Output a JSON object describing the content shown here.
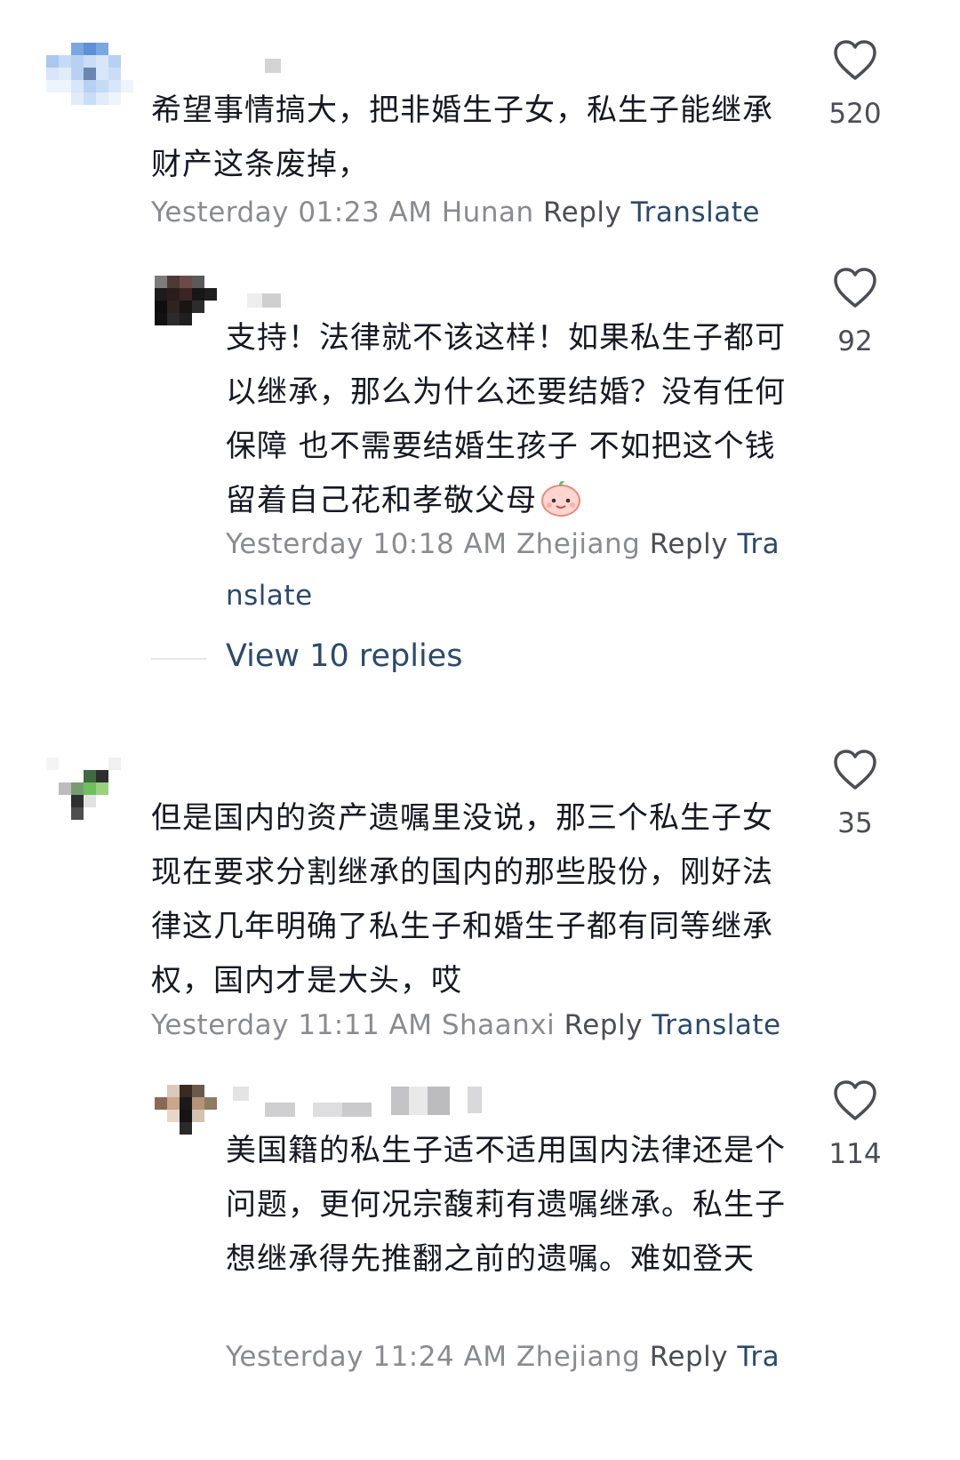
{
  "comments": [
    {
      "text": "希望事情搞大，把非婚生子女，私生子能继承财产这条废掉，",
      "time": "Yesterday 01:23 AM",
      "location": "Hunan",
      "reply": "Reply",
      "translate": "Translate",
      "likes": "520"
    },
    {
      "text": "支持！法律就不该这样！如果私生子都可以继承，那么为什么还要结婚？没有任何保障 也不需要结婚生孩子 不如把这个钱留着自己花和孝敬父母",
      "time": "Yesterday 10:18 AM",
      "location": "Zhejiang",
      "reply": "Reply",
      "translate": "Translate",
      "likes": "92"
    },
    {
      "text": "但是国内的资产遗嘱里没说，那三个私生子女现在要求分割继承的国内的那些股份，刚好法律这几年明确了私生子和婚生子都有同等继承权，国内才是大头，哎",
      "time": "Yesterday 11:11 AM",
      "location": "Shaanxi",
      "reply": "Reply",
      "translate": "Translate",
      "likes": "35"
    },
    {
      "text": "美国籍的私生子适不适用国内法律还是个问题，更何况宗馥莉有遗嘱继承。私生子想继承得先推翻之前的遗嘱。难如登天",
      "time": "Yesterday 11:24 AM",
      "location": "Zhejiang",
      "reply": "Reply",
      "translate": "Translate",
      "likes": "114"
    }
  ],
  "view_replies": "View 10 replies",
  "icons": {
    "like": "heart-outline-icon",
    "emoji": "smiling-face-emoji-icon"
  },
  "colors": {
    "text": "#161823",
    "meta": "#8a8b91",
    "link": "#2b4a6b"
  }
}
